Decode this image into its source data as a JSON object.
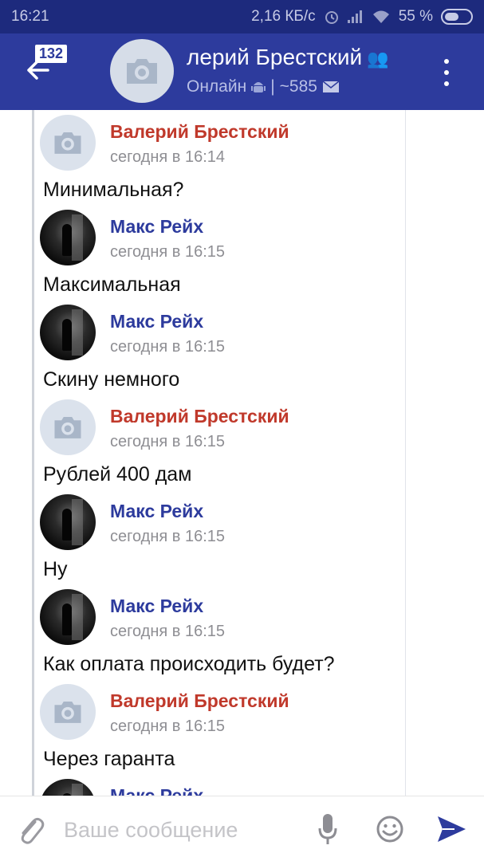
{
  "status_bar": {
    "time": "16:21",
    "net_speed": "2,16 КБ/с",
    "battery_pct": "55 %",
    "battery_level": 0.55
  },
  "header": {
    "unread_count": "132",
    "contact_name": "лерий Брестский",
    "status": "Онлайн",
    "separator": "|",
    "message_count": "~585"
  },
  "messages": [
    {
      "author": "Валерий Брестский",
      "time": "сегодня в 16:14",
      "text": "Минимальная?",
      "author_color": "#c0392b",
      "avatar": "placeholder"
    },
    {
      "author": "Макс Рейх",
      "time": "сегодня в 16:15",
      "text": "Максимальная",
      "author_color": "#2d3b9d",
      "avatar": "photo"
    },
    {
      "author": "Макс Рейх",
      "time": "сегодня в 16:15",
      "text": "Скину немного",
      "author_color": "#2d3b9d",
      "avatar": "photo"
    },
    {
      "author": "Валерий Брестский",
      "time": "сегодня в 16:15",
      "text": "Рублей 400 дам",
      "author_color": "#c0392b",
      "avatar": "placeholder"
    },
    {
      "author": "Макс Рейх",
      "time": "сегодня в 16:15",
      "text": "Ну",
      "author_color": "#2d3b9d",
      "avatar": "photo"
    },
    {
      "author": "Макс Рейх",
      "time": "сегодня в 16:15",
      "text": "Как оплата происходить будет?",
      "author_color": "#2d3b9d",
      "avatar": "photo"
    },
    {
      "author": "Валерий Брестский",
      "time": "сегодня в 16:15",
      "text": "Через гаранта",
      "author_color": "#c0392b",
      "avatar": "placeholder"
    },
    {
      "author": "Макс Рейх",
      "time": "",
      "text": "",
      "author_color": "#2d3b9d",
      "avatar": "photo"
    }
  ],
  "composer": {
    "placeholder": "Ваше сообщение",
    "value": ""
  },
  "colors": {
    "status_bar_bg": "#1d2a7d",
    "app_bar_bg": "#2d3b9d",
    "accent": "#2d3b9d",
    "other_author": "#c0392b"
  }
}
